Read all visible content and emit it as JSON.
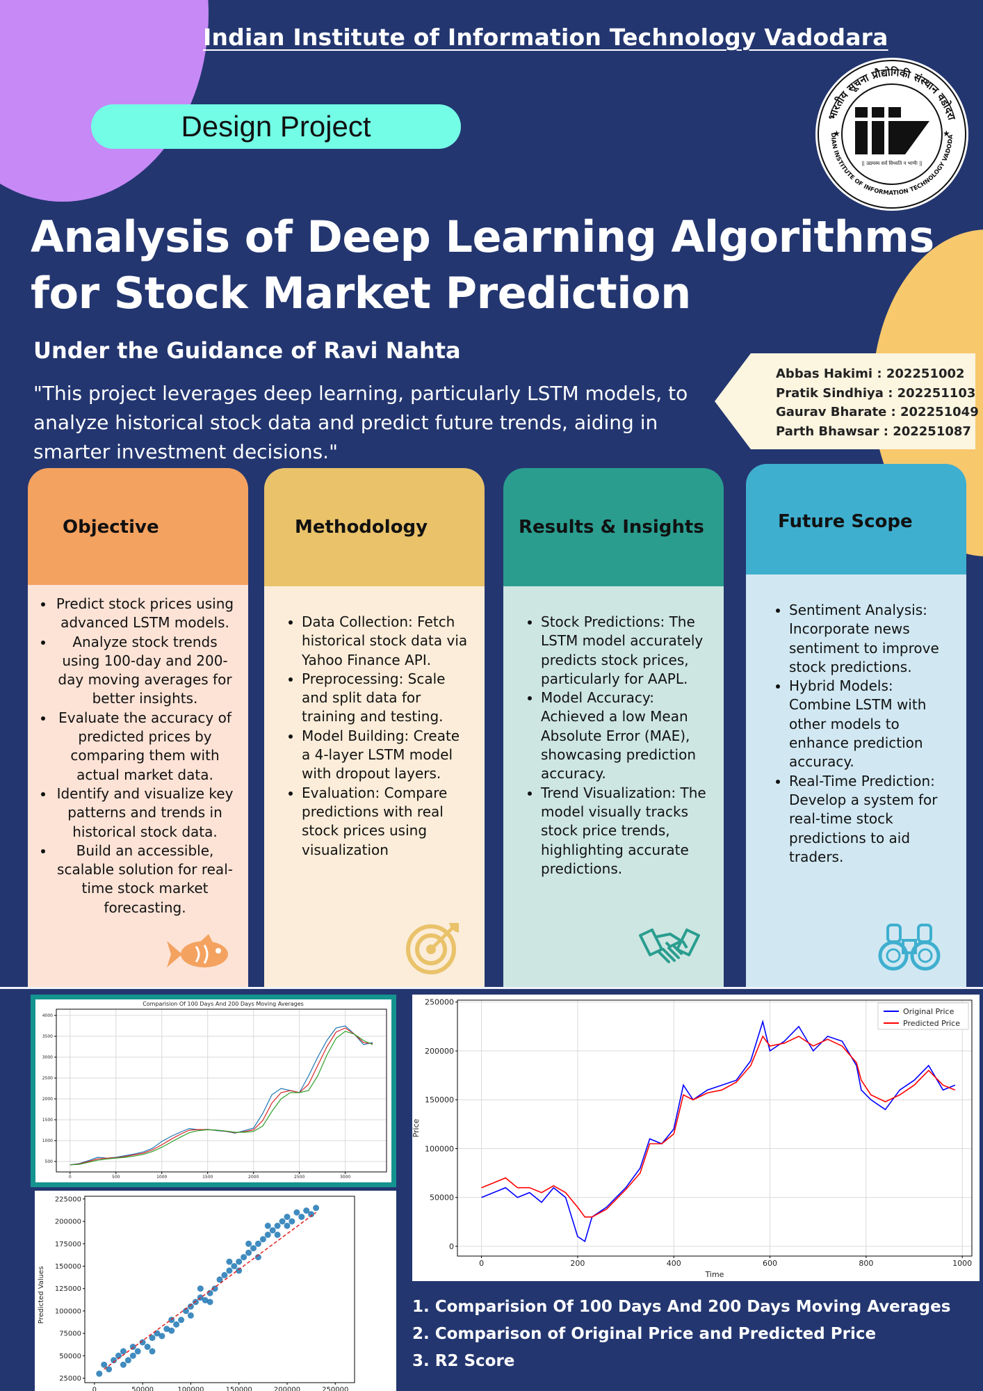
{
  "header": {
    "institute": "Indian Institute of Information Technology Vadodara",
    "badge": "Design Project",
    "logo": {
      "ring_text": "भारतीय सूचना प्रौद्योगिकी संस्थान वडोदरा",
      "ring_text_bottom": "INDIAN INSTITUTE OF INFORMATION TECHNOLOGY VADODARA",
      "motto": "|| उद्यमस्य सर्वं सिध्यति न भाग्यैः ||"
    }
  },
  "title": {
    "line1": "Analysis of Deep Learning Algorithms",
    "line2": "for Stock Market Prediction"
  },
  "guidance": "Under the Guidance of Ravi Nahta",
  "summary_quote": "\"This project leverages deep learning, particularly LSTM models, to analyze historical stock data and predict future trends, aiding in smarter investment decisions.\"",
  "authors": [
    "Abbas Hakimi : 202251002",
    "Pratik Sindhiya : 202251103",
    "Gaurav Bharate : 202251049",
    "Parth Bhawsar : 202251087"
  ],
  "sections": [
    {
      "title": "Objective",
      "items": [
        "Predict stock prices using advanced LSTM models.",
        "Analyze stock trends using 100-day and 200-day moving averages for better insights.",
        "Evaluate the accuracy of predicted prices by comparing them with actual market data.",
        "Identify and visualize key patterns and trends in historical stock data.",
        "Build an accessible, scalable solution for real-time stock market forecasting."
      ],
      "icon": "fish-icon"
    },
    {
      "title": "Methodology",
      "items": [
        "Data Collection: Fetch historical stock data via Yahoo Finance API.",
        "Preprocessing: Scale and split data for training and testing.",
        "Model Building: Create a 4-layer LSTM model with dropout layers.",
        "Evaluation: Compare predictions with real stock prices using visualization"
      ],
      "icon": "target-icon"
    },
    {
      "title": "Results & Insights",
      "items": [
        "Stock Predictions: The LSTM model accurately predicts stock prices, particularly for AAPL.",
        "Model Accuracy: Achieved a low Mean Absolute Error (MAE), showcasing prediction accuracy.",
        "Trend Visualization: The model visually tracks stock price trends, highlighting accurate predictions."
      ],
      "icon": "handshake-icon"
    },
    {
      "title": "Future Scope",
      "items": [
        "Sentiment Analysis: Incorporate news sentiment to improve stock predictions.",
        "Hybrid Models: Combine LSTM with other models to enhance prediction accuracy.",
        "Real-Time Prediction: Develop a system for real-time stock predictions to aid traders."
      ],
      "icon": "binoculars-icon"
    }
  ],
  "colors": {
    "background": "#233670",
    "objective_head": "#f4a260",
    "objective_body": "#fce3d6",
    "methodology_head": "#e9c26a",
    "methodology_body": "#fbedd9",
    "results_head": "#2a9d8f",
    "results_body": "#cde6e2",
    "future_head": "#3fafcf",
    "future_body": "#d1e8f2",
    "series_original": "#0000ff",
    "series_predicted": "#ff0000",
    "scatter_points": "#1f77b4"
  },
  "chart_data": [
    {
      "type": "line",
      "title": "Comparision Of 100 Days And 200 Days Moving Averages",
      "xticks": [
        "0",
        "500",
        "1000",
        "1500",
        "2000",
        "2500",
        "3000"
      ],
      "yticks": [
        "500",
        "1000",
        "1500",
        "2000",
        "2500",
        "3000",
        "3500",
        "4000"
      ],
      "xlim": [
        -150,
        3450
      ],
      "ylim": [
        250,
        4150
      ],
      "x": [
        0,
        100,
        200,
        300,
        400,
        500,
        600,
        700,
        800,
        900,
        1000,
        1100,
        1200,
        1300,
        1400,
        1500,
        1600,
        1700,
        1800,
        1900,
        2000,
        2100,
        2200,
        2300,
        2400,
        2500,
        2600,
        2700,
        2800,
        2900,
        3000,
        3100,
        3200,
        3300
      ],
      "series": [
        {
          "values": [
            420,
            450,
            520,
            600,
            580,
            600,
            640,
            680,
            730,
            820,
            980,
            1100,
            1200,
            1290,
            1260,
            1270,
            1240,
            1220,
            1180,
            1240,
            1300,
            1650,
            2100,
            2250,
            2200,
            2150,
            2550,
            3000,
            3400,
            3700,
            3750,
            3550,
            3300,
            3350
          ],
          "color": "#1f77b4"
        },
        {
          "values": [
            420,
            440,
            500,
            560,
            580,
            590,
            620,
            660,
            700,
            780,
            900,
            1030,
            1150,
            1250,
            1265,
            1265,
            1250,
            1225,
            1190,
            1215,
            1260,
            1480,
            1900,
            2150,
            2200,
            2150,
            2350,
            2800,
            3250,
            3600,
            3700,
            3550,
            3350,
            3320
          ],
          "color": "#d62728"
        },
        {
          "values": [
            420,
            430,
            480,
            530,
            560,
            580,
            600,
            630,
            670,
            740,
            840,
            960,
            1080,
            1190,
            1240,
            1260,
            1250,
            1230,
            1200,
            1200,
            1220,
            1350,
            1700,
            2000,
            2150,
            2150,
            2200,
            2550,
            3050,
            3450,
            3620,
            3550,
            3400,
            3300
          ],
          "color": "#2ca02c"
        }
      ]
    },
    {
      "type": "line",
      "xlabel": "Time",
      "ylabel": "Price",
      "xticks": [
        "0",
        "200",
        "400",
        "600",
        "800",
        "1000"
      ],
      "yticks": [
        "0",
        "50000",
        "100000",
        "150000",
        "200000",
        "250000"
      ],
      "xlim": [
        -50,
        1020
      ],
      "ylim": [
        -10000,
        252000
      ],
      "legend_position": "top-right",
      "x": [
        0,
        25,
        50,
        75,
        100,
        125,
        150,
        175,
        200,
        215,
        230,
        260,
        300,
        330,
        350,
        375,
        400,
        420,
        440,
        470,
        500,
        530,
        560,
        585,
        600,
        630,
        660,
        690,
        720,
        750,
        780,
        790,
        810,
        840,
        870,
        900,
        930,
        960,
        985
      ],
      "series": [
        {
          "name": "Original Price",
          "values": [
            50000,
            55000,
            60000,
            50000,
            55000,
            45000,
            60000,
            50000,
            10000,
            5000,
            30000,
            40000,
            60000,
            80000,
            110000,
            105000,
            120000,
            165000,
            150000,
            160000,
            165000,
            170000,
            190000,
            230000,
            200000,
            210000,
            225000,
            200000,
            215000,
            210000,
            185000,
            160000,
            150000,
            140000,
            160000,
            170000,
            185000,
            160000,
            165000
          ],
          "color": "#0000ff"
        },
        {
          "name": "Predicted Price",
          "values": [
            60000,
            65000,
            70000,
            60000,
            60000,
            55000,
            62000,
            55000,
            40000,
            30000,
            30000,
            38000,
            58000,
            75000,
            105000,
            105000,
            115000,
            155000,
            150000,
            157000,
            160000,
            168000,
            185000,
            215000,
            205000,
            208000,
            215000,
            205000,
            212000,
            205000,
            188000,
            170000,
            155000,
            148000,
            155000,
            165000,
            180000,
            165000,
            160000
          ],
          "color": "#ff0000"
        }
      ]
    },
    {
      "type": "scatter",
      "ylabel": "Predicted Values",
      "xticks": [
        "0",
        "50000",
        "100000",
        "150000",
        "200000",
        "250000"
      ],
      "yticks": [
        "25000",
        "50000",
        "75000",
        "100000",
        "125000",
        "150000",
        "175000",
        "200000",
        "225000"
      ],
      "xlim": [
        -10000,
        270000
      ],
      "ylim": [
        20000,
        228000
      ],
      "points": [
        [
          5000,
          30000
        ],
        [
          10000,
          40000
        ],
        [
          15000,
          35000
        ],
        [
          20000,
          45000
        ],
        [
          25000,
          50000
        ],
        [
          30000,
          55000
        ],
        [
          35000,
          45000
        ],
        [
          40000,
          60000
        ],
        [
          45000,
          55000
        ],
        [
          50000,
          65000
        ],
        [
          55000,
          60000
        ],
        [
          60000,
          70000
        ],
        [
          65000,
          75000
        ],
        [
          70000,
          72000
        ],
        [
          75000,
          80000
        ],
        [
          80000,
          78000
        ],
        [
          85000,
          85000
        ],
        [
          90000,
          90000
        ],
        [
          95000,
          100000
        ],
        [
          100000,
          105000
        ],
        [
          105000,
          110000
        ],
        [
          110000,
          115000
        ],
        [
          115000,
          112000
        ],
        [
          120000,
          120000
        ],
        [
          125000,
          125000
        ],
        [
          130000,
          135000
        ],
        [
          135000,
          140000
        ],
        [
          140000,
          145000
        ],
        [
          145000,
          150000
        ],
        [
          150000,
          155000
        ],
        [
          155000,
          160000
        ],
        [
          160000,
          165000
        ],
        [
          165000,
          170000
        ],
        [
          170000,
          175000
        ],
        [
          175000,
          180000
        ],
        [
          180000,
          185000
        ],
        [
          185000,
          190000
        ],
        [
          190000,
          195000
        ],
        [
          195000,
          200000
        ],
        [
          200000,
          205000
        ],
        [
          205000,
          200000
        ],
        [
          210000,
          210000
        ],
        [
          215000,
          205000
        ],
        [
          220000,
          212000
        ],
        [
          225000,
          208000
        ],
        [
          230000,
          215000
        ],
        [
          150000,
          145000
        ],
        [
          160000,
          175000
        ],
        [
          170000,
          160000
        ],
        [
          140000,
          155000
        ],
        [
          120000,
          110000
        ],
        [
          110000,
          125000
        ],
        [
          180000,
          195000
        ],
        [
          190000,
          185000
        ],
        [
          200000,
          195000
        ],
        [
          30000,
          40000
        ],
        [
          60000,
          55000
        ],
        [
          40000,
          50000
        ],
        [
          80000,
          90000
        ],
        [
          100000,
          95000
        ]
      ],
      "trendline": [
        [
          10000,
          35000
        ],
        [
          230000,
          210000
        ]
      ]
    }
  ],
  "figure_captions": [
    "1.  Comparision Of 100 Days And 200 Days Moving Averages",
    "2. Comparison of Original Price and Predicted Price",
    "3. R2 Score"
  ]
}
